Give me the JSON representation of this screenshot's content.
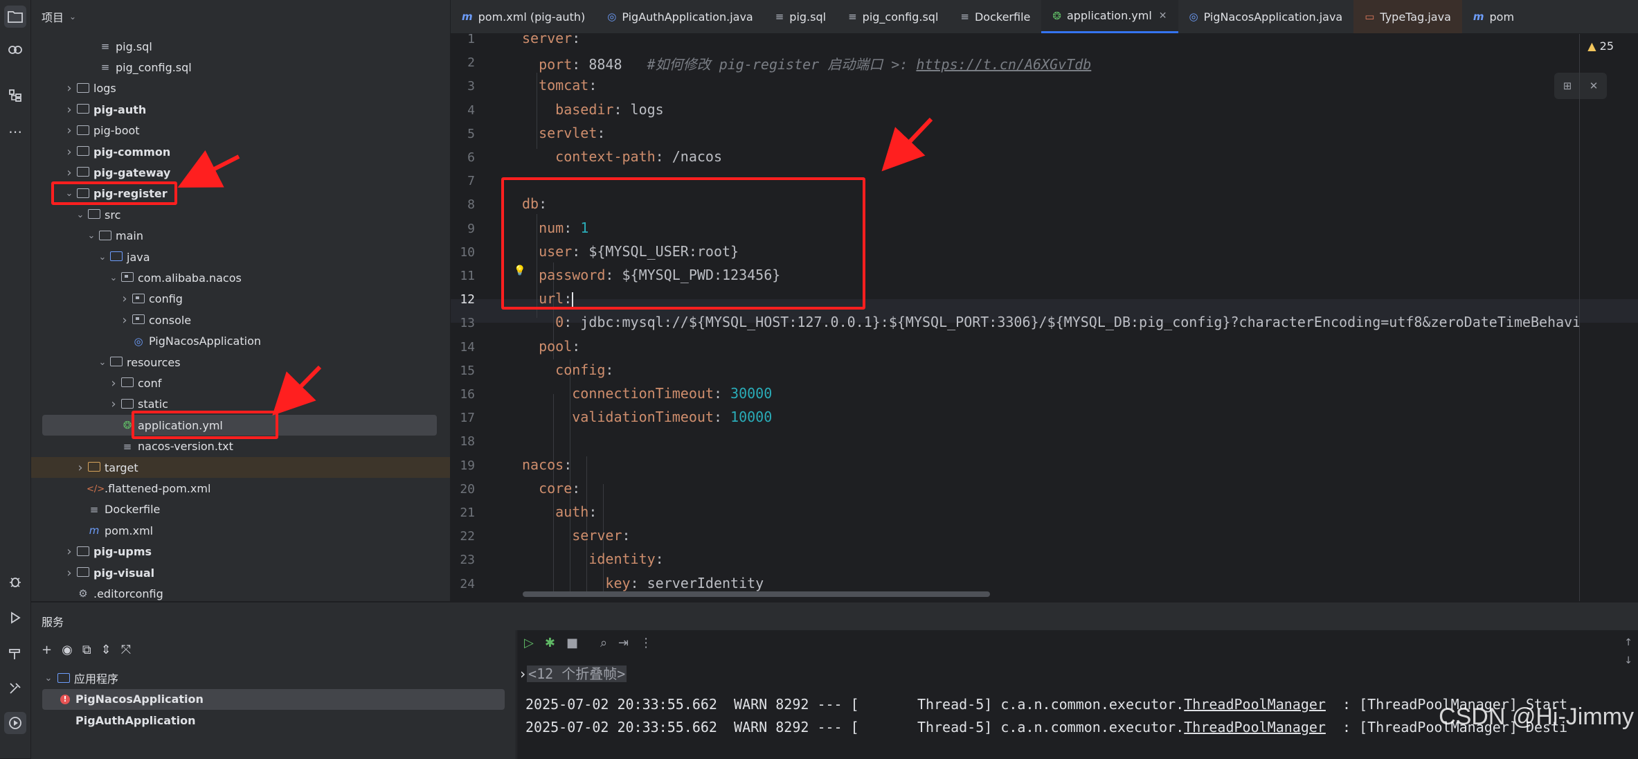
{
  "activity_bar": {
    "top_icons": [
      "folder-icon",
      "copilot-icon",
      "structure-icon",
      "more-icon"
    ],
    "bottom_icons": [
      "debug-icon",
      "run-icon",
      "build-icon",
      "tools-icon",
      "services-icon"
    ]
  },
  "project": {
    "header": "项目",
    "tree": [
      {
        "label": "pig.sql",
        "indent": 3,
        "arrow": "",
        "icon": "file",
        "bold": false
      },
      {
        "label": "pig_config.sql",
        "indent": 3,
        "arrow": "",
        "icon": "file",
        "bold": false
      },
      {
        "label": "logs",
        "indent": 1,
        "arrow": ">",
        "icon": "folder",
        "bold": false
      },
      {
        "label": "pig-auth",
        "indent": 1,
        "arrow": ">",
        "icon": "folder",
        "bold": true
      },
      {
        "label": "pig-boot",
        "indent": 1,
        "arrow": ">",
        "icon": "folder",
        "bold": false
      },
      {
        "label": "pig-common",
        "indent": 1,
        "arrow": ">",
        "icon": "folder",
        "bold": true
      },
      {
        "label": "pig-gateway",
        "indent": 1,
        "arrow": ">",
        "icon": "folder",
        "bold": true
      },
      {
        "label": "pig-register",
        "indent": 1,
        "arrow": "v",
        "icon": "folder",
        "bold": true
      },
      {
        "label": "src",
        "indent": 2,
        "arrow": "v",
        "icon": "folder",
        "bold": false
      },
      {
        "label": "main",
        "indent": 3,
        "arrow": "v",
        "icon": "folder",
        "bold": false
      },
      {
        "label": "java",
        "indent": 4,
        "arrow": "v",
        "icon": "folder-blue",
        "bold": false
      },
      {
        "label": "com.alibaba.nacos",
        "indent": 5,
        "arrow": "v",
        "icon": "package",
        "bold": false
      },
      {
        "label": "config",
        "indent": 6,
        "arrow": ">",
        "icon": "package",
        "bold": false
      },
      {
        "label": "console",
        "indent": 6,
        "arrow": ">",
        "icon": "package",
        "bold": false
      },
      {
        "label": "PigNacosApplication",
        "indent": 6,
        "arrow": "",
        "icon": "class",
        "bold": false
      },
      {
        "label": "resources",
        "indent": 4,
        "arrow": "v",
        "icon": "folder",
        "bold": false
      },
      {
        "label": "conf",
        "indent": 5,
        "arrow": ">",
        "icon": "folder",
        "bold": false
      },
      {
        "label": "static",
        "indent": 5,
        "arrow": ">",
        "icon": "folder",
        "bold": false
      },
      {
        "label": "application.yml",
        "indent": 5,
        "arrow": "",
        "icon": "spring",
        "bold": false
      },
      {
        "label": "nacos-version.txt",
        "indent": 5,
        "arrow": "",
        "icon": "file",
        "bold": false
      },
      {
        "label": "target",
        "indent": 2,
        "arrow": ">",
        "icon": "folder-orange",
        "bold": false
      },
      {
        "label": ".flattened-pom.xml",
        "indent": 2,
        "arrow": "",
        "icon": "xml",
        "bold": false
      },
      {
        "label": "Dockerfile",
        "indent": 2,
        "arrow": "",
        "icon": "file",
        "bold": false
      },
      {
        "label": "pom.xml",
        "indent": 2,
        "arrow": "",
        "icon": "maven",
        "bold": false
      },
      {
        "label": "pig-upms",
        "indent": 1,
        "arrow": ">",
        "icon": "folder",
        "bold": true
      },
      {
        "label": "pig-visual",
        "indent": 1,
        "arrow": ">",
        "icon": "folder",
        "bold": true
      },
      {
        "label": ".editorconfig",
        "indent": 1,
        "arrow": "",
        "icon": "gear",
        "bold": false
      }
    ]
  },
  "tabs": [
    {
      "label": "pom.xml (pig-auth)",
      "icon": "m",
      "active": false
    },
    {
      "label": "PigAuthApplication.java",
      "icon": "class",
      "active": false
    },
    {
      "label": "pig.sql",
      "icon": "file",
      "active": false
    },
    {
      "label": "pig_config.sql",
      "icon": "file",
      "active": false
    },
    {
      "label": "Dockerfile",
      "icon": "file",
      "active": false
    },
    {
      "label": "application.yml",
      "icon": "spring",
      "active": true
    },
    {
      "label": "PigNacosApplication.java",
      "icon": "class",
      "active": false
    },
    {
      "label": "TypeTag.java",
      "icon": "java",
      "active": false
    },
    {
      "label": "pom",
      "icon": "m",
      "active": false
    }
  ],
  "editor": {
    "warning_count": "25",
    "current_line": 12,
    "lines": [
      [
        [
          "k",
          "server"
        ],
        [
          "v",
          ":"
        ]
      ],
      [
        [
          "v",
          "  "
        ],
        [
          "k",
          "port"
        ],
        [
          "v",
          ": 8848   "
        ],
        [
          "c",
          "#如何修改 pig-register 启动端口 >: "
        ],
        [
          "c-link",
          "https://t.cn/A6XGvTdb"
        ]
      ],
      [
        [
          "v",
          "  "
        ],
        [
          "k",
          "tomcat"
        ],
        [
          "v",
          ":"
        ]
      ],
      [
        [
          "v",
          "    "
        ],
        [
          "k",
          "basedir"
        ],
        [
          "v",
          ": logs"
        ]
      ],
      [
        [
          "v",
          "  "
        ],
        [
          "k",
          "servlet"
        ],
        [
          "v",
          ":"
        ]
      ],
      [
        [
          "v",
          "    "
        ],
        [
          "k",
          "context-path"
        ],
        [
          "v",
          ": /nacos"
        ]
      ],
      [],
      [
        [
          "k",
          "db"
        ],
        [
          "v",
          ":"
        ]
      ],
      [
        [
          "v",
          "  "
        ],
        [
          "k",
          "num"
        ],
        [
          "v",
          ": "
        ],
        [
          "n",
          "1"
        ]
      ],
      [
        [
          "v",
          "  "
        ],
        [
          "k",
          "user"
        ],
        [
          "v",
          ": ${MYSQL_USER:root}"
        ]
      ],
      [
        [
          "v",
          "  "
        ],
        [
          "k",
          "password"
        ],
        [
          "v",
          ": ${MYSQL_PWD:123456}"
        ]
      ],
      [
        [
          "v",
          "  "
        ],
        [
          "k",
          "url"
        ],
        [
          "v",
          ":"
        ]
      ],
      [
        [
          "v",
          "    "
        ],
        [
          "k",
          "0"
        ],
        [
          "v",
          ": jdbc:mysql://${MYSQL_HOST:127.0.0.1}:${MYSQL_PORT:3306}/${MYSQL_DB:pig_config}?characterEncoding=utf8&zeroDateTimeBehavi"
        ]
      ],
      [
        [
          "v",
          "  "
        ],
        [
          "k",
          "pool"
        ],
        [
          "v",
          ":"
        ]
      ],
      [
        [
          "v",
          "    "
        ],
        [
          "k",
          "config"
        ],
        [
          "v",
          ":"
        ]
      ],
      [
        [
          "v",
          "      "
        ],
        [
          "k",
          "connectionTimeout"
        ],
        [
          "v",
          ": "
        ],
        [
          "n",
          "30000"
        ]
      ],
      [
        [
          "v",
          "      "
        ],
        [
          "k",
          "validationTimeout"
        ],
        [
          "v",
          ": "
        ],
        [
          "n",
          "10000"
        ]
      ],
      [],
      [
        [
          "k",
          "nacos"
        ],
        [
          "v",
          ":"
        ]
      ],
      [
        [
          "v",
          "  "
        ],
        [
          "k",
          "core"
        ],
        [
          "v",
          ":"
        ]
      ],
      [
        [
          "v",
          "    "
        ],
        [
          "k",
          "auth"
        ],
        [
          "v",
          ":"
        ]
      ],
      [
        [
          "v",
          "      "
        ],
        [
          "k",
          "server"
        ],
        [
          "v",
          ":"
        ]
      ],
      [
        [
          "v",
          "        "
        ],
        [
          "k",
          "identity"
        ],
        [
          "v",
          ":"
        ]
      ],
      [
        [
          "v",
          "          "
        ],
        [
          "k",
          "key"
        ],
        [
          "v",
          ": serverIdentity"
        ]
      ]
    ]
  },
  "services": {
    "title": "服务",
    "toolbar": [
      "add-icon",
      "eye-icon",
      "new-tab-icon",
      "expand-icon",
      "collapse-icon"
    ],
    "tree": [
      {
        "label": "应用程序",
        "indent": 0,
        "arrow": "v",
        "bold": false,
        "error": false,
        "selected": false
      },
      {
        "label": "PigNacosApplication",
        "indent": 1,
        "arrow": "",
        "bold": true,
        "error": true,
        "selected": true
      },
      {
        "label": "PigAuthApplication",
        "indent": 1,
        "arrow": "",
        "bold": true,
        "error": false,
        "selected": false
      }
    ],
    "console": {
      "fold": "<12 个折叠帧>",
      "log_lines": [
        {
          "time": "2025-07-02 20:33:55.662",
          "rest": "  WARN 8292 --- [       Thread-5] c.a.n.common.executor.",
          "link": "ThreadPoolManager",
          "tail": "  : [ThreadPoolManager] Start"
        },
        {
          "time": "2025-07-02 20:33:55.662",
          "rest": "  WARN 8292 --- [       Thread-5] c.a.n.common.executor.",
          "link": "ThreadPoolManager",
          "tail": "  : [ThreadPoolManager] Desti"
        }
      ]
    }
  },
  "watermark": "CSDN @Hi-Jimmy"
}
